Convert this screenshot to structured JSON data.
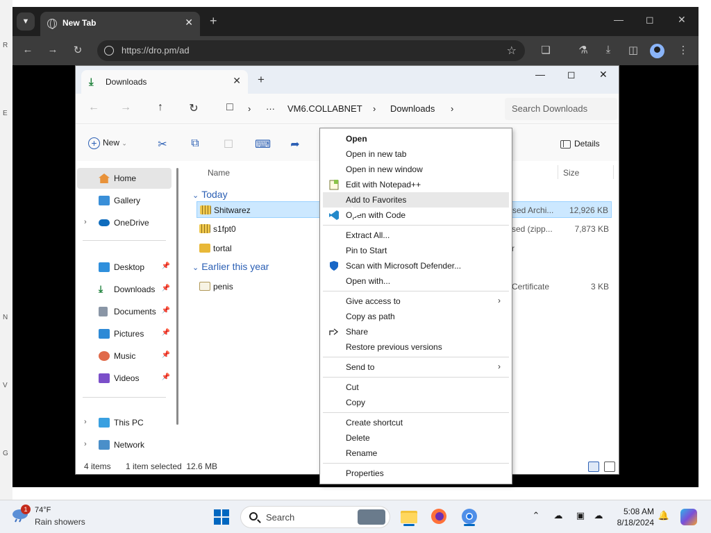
{
  "desktop": {
    "edge_letters": [
      "R",
      "E",
      "N",
      "V",
      "G"
    ]
  },
  "browser": {
    "tab_title": "New Tab",
    "url": "https://dro.pm/ad"
  },
  "explorer": {
    "tab_title": "Downloads",
    "breadcrumb": [
      "VM6.COLLABNET",
      "Downloads"
    ],
    "search_placeholder": "Search Downloads",
    "new_label": "New",
    "details_label": "Details",
    "columns": {
      "name": "Name",
      "size": "Size"
    },
    "sidebar": {
      "top": [
        {
          "label": "Home",
          "selected": true
        },
        {
          "label": "Gallery"
        },
        {
          "label": "OneDrive",
          "expandable": true
        }
      ],
      "quick": [
        {
          "label": "Desktop"
        },
        {
          "label": "Downloads"
        },
        {
          "label": "Documents"
        },
        {
          "label": "Pictures"
        },
        {
          "label": "Music"
        },
        {
          "label": "Videos"
        }
      ],
      "bottom": [
        {
          "label": "This PC"
        },
        {
          "label": "Network"
        }
      ]
    },
    "groups": [
      {
        "title": "Today",
        "files": [
          {
            "name": "Shitwarez",
            "type": "sed Archi...",
            "size": "12,926 KB",
            "selected": true
          },
          {
            "name": "s1fpt0",
            "type": "sed (zipp...",
            "size": "7,873 KB"
          },
          {
            "name": "tortal",
            "type": "r",
            "size": ""
          }
        ]
      },
      {
        "title": "Earlier this year",
        "files": [
          {
            "name": "penis",
            "type": "Certificate",
            "size": "3 KB"
          }
        ]
      }
    ],
    "status": {
      "count": "4 items",
      "selection": "1 item selected  12.6 MB"
    }
  },
  "context_menu": {
    "items": [
      {
        "label": "Open",
        "bold": true
      },
      {
        "label": "Open in new tab"
      },
      {
        "label": "Open in new window"
      },
      {
        "label": "Edit with Notepad++",
        "icon": "notepad-plus-plus-icon"
      },
      {
        "label": "Add to Favorites",
        "hover": true
      },
      {
        "label": "Open with Code",
        "icon": "vscode-icon"
      },
      {
        "separator": true
      },
      {
        "label": "Extract All..."
      },
      {
        "label": "Pin to Start"
      },
      {
        "label": "Scan with Microsoft Defender...",
        "icon": "defender-shield-icon"
      },
      {
        "label": "Open with..."
      },
      {
        "separator": true
      },
      {
        "label": "Give access to",
        "submenu": true
      },
      {
        "label": "Copy as path"
      },
      {
        "label": "Share",
        "icon": "share-icon"
      },
      {
        "label": "Restore previous versions"
      },
      {
        "separator": true
      },
      {
        "label": "Send to",
        "submenu": true
      },
      {
        "separator": true
      },
      {
        "label": "Cut"
      },
      {
        "label": "Copy"
      },
      {
        "separator": true
      },
      {
        "label": "Create shortcut"
      },
      {
        "label": "Delete"
      },
      {
        "label": "Rename"
      },
      {
        "separator": true
      },
      {
        "label": "Properties"
      }
    ]
  },
  "taskbar": {
    "weather_badge": "1",
    "temperature": "74°F",
    "weather_desc": "Rain showers",
    "search_label": "Search",
    "time": "5:08 AM",
    "date": "8/18/2024"
  }
}
